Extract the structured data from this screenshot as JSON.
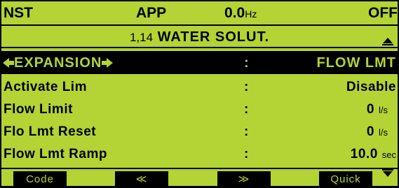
{
  "header": {
    "nst": "NST",
    "app": "APP",
    "freq_value": "0.0",
    "freq_unit": "Hz",
    "status": "OFF"
  },
  "title": {
    "number": "1,14",
    "text": "WATER SOLUT."
  },
  "selected": {
    "label": "EXPANSION",
    "separator": ":",
    "value": "FLOW LMT"
  },
  "params": [
    {
      "label": "Activate Lim",
      "separator": ":",
      "value": "Disable",
      "unit": ""
    },
    {
      "label": "Flow Limit",
      "separator": ":",
      "value": "0",
      "unit": "l/s"
    },
    {
      "label": "Flo Lmt Reset",
      "separator": ":",
      "value": "0",
      "unit": "l/s"
    },
    {
      "label": "Flow Lmt Ramp",
      "separator": ":",
      "value": "10.0",
      "unit": "sec"
    }
  ],
  "softkeys": {
    "code": "Code",
    "prev": "≪",
    "next": "≫",
    "quick": "Quick"
  },
  "colors": {
    "background": "#b4d335",
    "foreground": "#000000"
  },
  "icons": {
    "scroll_up": "triangle-up-icon",
    "scroll_down": "triangle-down-icon",
    "left": "arrow-left-icon",
    "right": "arrow-right-icon"
  }
}
